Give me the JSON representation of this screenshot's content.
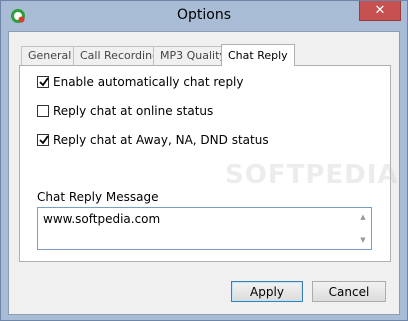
{
  "window": {
    "title": "Options",
    "close_label": "✕"
  },
  "tabs": [
    {
      "label": "General",
      "active": false
    },
    {
      "label": "Call Recording",
      "active": false
    },
    {
      "label": "MP3 Quality",
      "active": false
    },
    {
      "label": "Chat Reply",
      "active": true
    }
  ],
  "options": [
    {
      "label": "Enable automatically chat reply",
      "checked": true
    },
    {
      "label": "Reply chat at online status",
      "checked": false
    },
    {
      "label": "Reply chat at Away, NA, DND status",
      "checked": true
    }
  ],
  "message": {
    "label": "Chat Reply Message",
    "value": "www.softpedia.com"
  },
  "buttons": {
    "apply": "Apply",
    "cancel": "Cancel"
  },
  "colors": {
    "frame": "#a8bcd6",
    "close": "#c75050",
    "accent": "#3c7fb1"
  }
}
